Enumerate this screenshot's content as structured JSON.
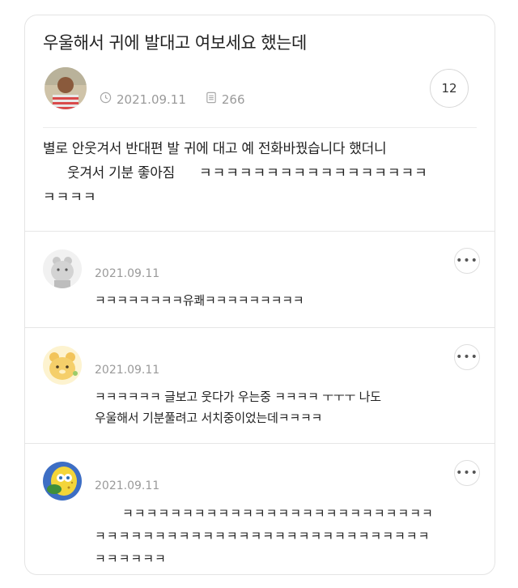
{
  "post": {
    "title": "우울해서 귀에 발대고 여보세요 했는데",
    "date": "2021.09.11",
    "views": "266",
    "comment_count": "12",
    "body_line1": "별로 안웃겨서 반대편 발 귀에 대고 예 전화바꿨습니다 했더니",
    "body_line2_a": "웃겨서 기분 좋아짐",
    "body_line2_b": "ㅋㅋㅋㅋㅋㅋㅋㅋㅋㅋㅋㅋㅋㅋㅋㅋㅋ",
    "body_line3": "ㅋㅋㅋㅋ"
  },
  "comments": [
    {
      "date": "2021.09.11",
      "more_label": "•••",
      "text_line1": "ㅋㅋㅋㅋㅋㅋㅋㅋ유쾌ㅋㅋㅋㅋㅋㅋㅋㅋㅋ"
    },
    {
      "date": "2021.09.11",
      "more_label": "•••",
      "text_line1": "ㅋㅋㅋㅋㅋㅋ 글보고 웃다가 우는중 ㅋㅋㅋㅋ ㅜㅜㅜ 나도",
      "text_line2": "우울해서 기분풀려고 서치중이었는데ㅋㅋㅋㅋ"
    },
    {
      "date": "2021.09.11",
      "more_label": "•••",
      "text_line1": "ㅋㅋㅋㅋㅋㅋㅋㅋㅋㅋㅋㅋㅋㅋㅋㅋㅋㅋㅋㅋㅋㅋㅋㅋㅋㅋ",
      "text_line2": "ㅋㅋㅋㅋㅋㅋㅋㅋㅋㅋㅋㅋㅋㅋㅋㅋㅋㅋㅋㅋㅋㅋㅋㅋㅋㅋㅋㅋ",
      "text_line3": "ㅋㅋㅋㅋㅋㅋ"
    }
  ],
  "icons": {
    "clock": "clock-icon",
    "views": "document-icon",
    "more": "more-options-icon"
  },
  "colors": {
    "meta_text": "#9a9a9a",
    "border": "#e4e4e4",
    "text": "#222222"
  }
}
